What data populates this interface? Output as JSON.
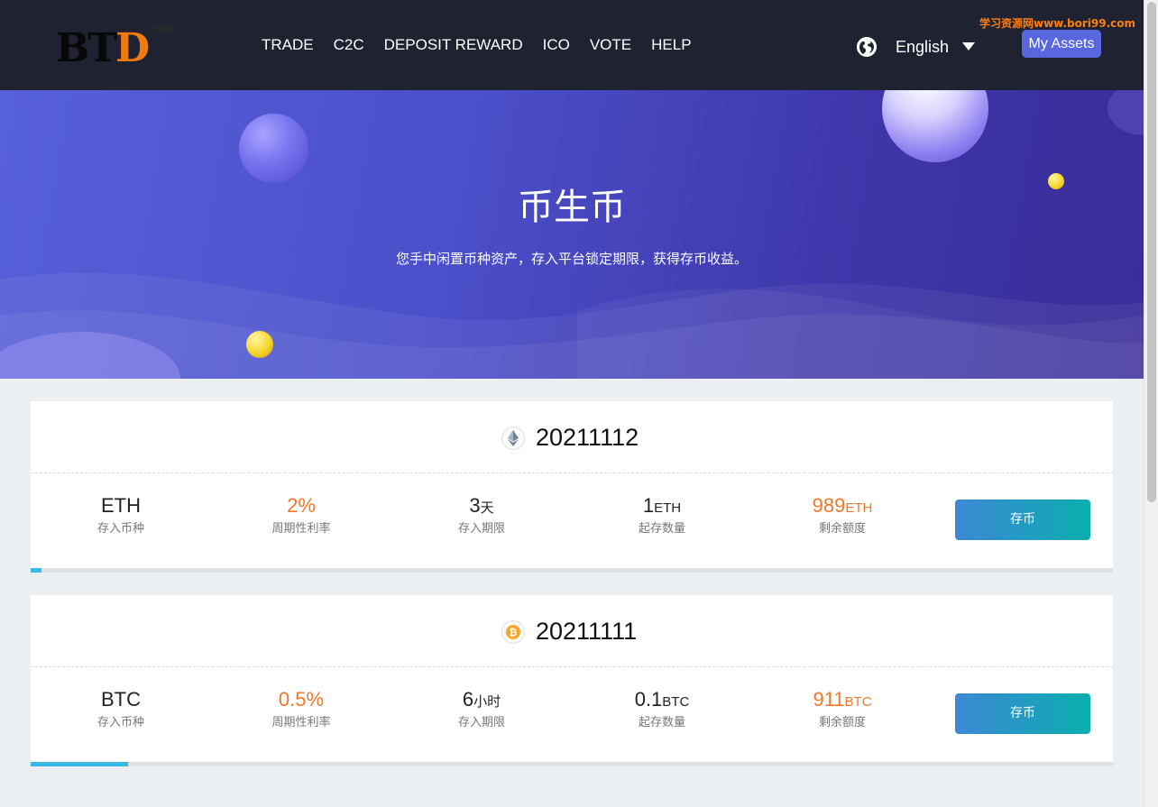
{
  "header": {
    "logo": {
      "main_bt": "BT",
      "main_d": "D",
      "pro": "PRO"
    },
    "nav": [
      "TRADE",
      "C2C",
      "DEPOSIT REWARD",
      "ICO",
      "VOTE",
      "HELP"
    ],
    "language": "English",
    "watermark": "学习资源网www.bori99.com",
    "my_assets": "My Assets"
  },
  "hero": {
    "title": "币生币",
    "subtitle": "您手中闲置币种资产，存入平台锁定期限，获得存币收益。"
  },
  "colors": {
    "header_bg": "#1f2230",
    "accent_orange": "#f0772a",
    "assets_button": "#5867dd",
    "progress": "#39b7e5"
  },
  "cards": [
    {
      "coin_icon": "ethereum-icon",
      "title": "20211112",
      "coin": "ETH",
      "coin_label": "存入币种",
      "rate": "2%",
      "rate_label": "周期性利率",
      "period_value": "3",
      "period_unit": "天",
      "period_label": "存入期限",
      "min_value": "1",
      "min_unit": "ETH",
      "min_label": "起存数量",
      "remain_value": "989",
      "remain_unit": "ETH",
      "remain_label": "剩余额度",
      "button": "存币",
      "progress": 0.01
    },
    {
      "coin_icon": "bitcoin-icon",
      "title": "20211111",
      "coin": "BTC",
      "coin_label": "存入币种",
      "rate": "0.5%",
      "rate_label": "周期性利率",
      "period_value": "6",
      "period_unit": "小时",
      "period_label": "存入期限",
      "min_value": "0.1",
      "min_unit": "BTC",
      "min_label": "起存数量",
      "remain_value": "911",
      "remain_unit": "BTC",
      "remain_label": "剩余额度",
      "button": "存币",
      "progress": 0.09
    }
  ]
}
